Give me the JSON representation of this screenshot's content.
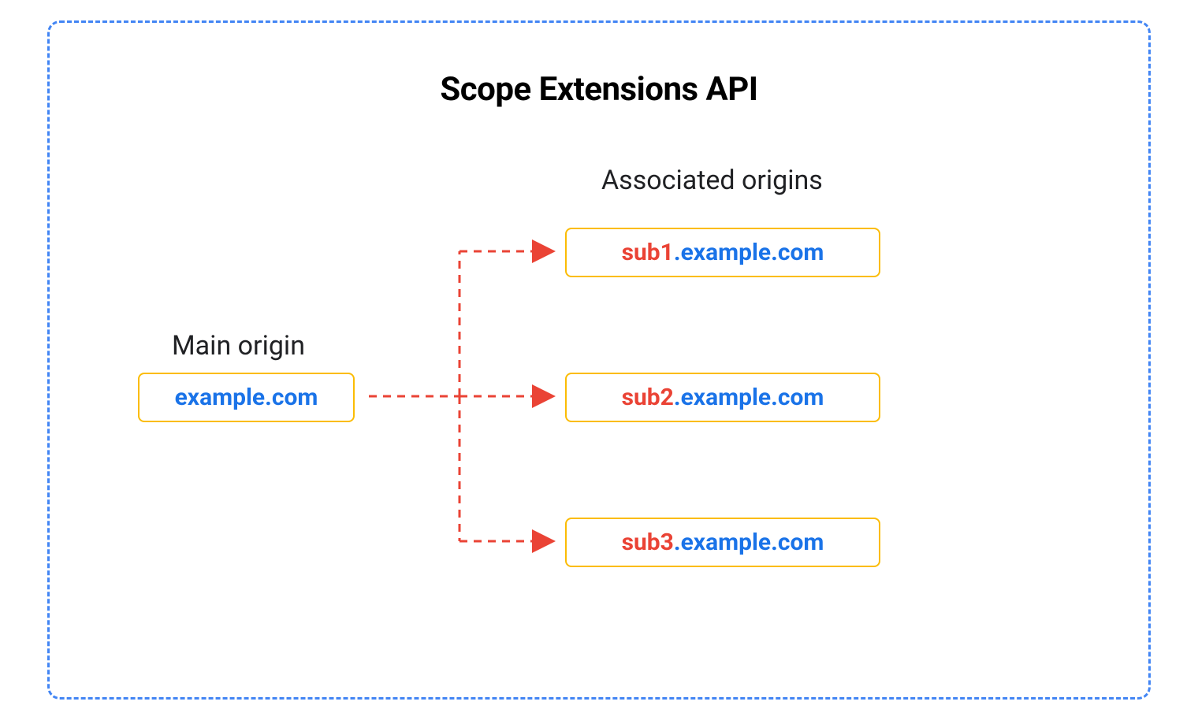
{
  "diagram": {
    "title": "Scope Extensions API",
    "main_origin_label": "Main origin",
    "associated_origins_label": "Associated origins",
    "main_origin": {
      "domain": "example.com"
    },
    "associated_origins": [
      {
        "subdomain": "sub1",
        "domain": ".example.com"
      },
      {
        "subdomain": "sub2",
        "domain": ".example.com"
      },
      {
        "subdomain": "sub3",
        "domain": ".example.com"
      }
    ]
  }
}
